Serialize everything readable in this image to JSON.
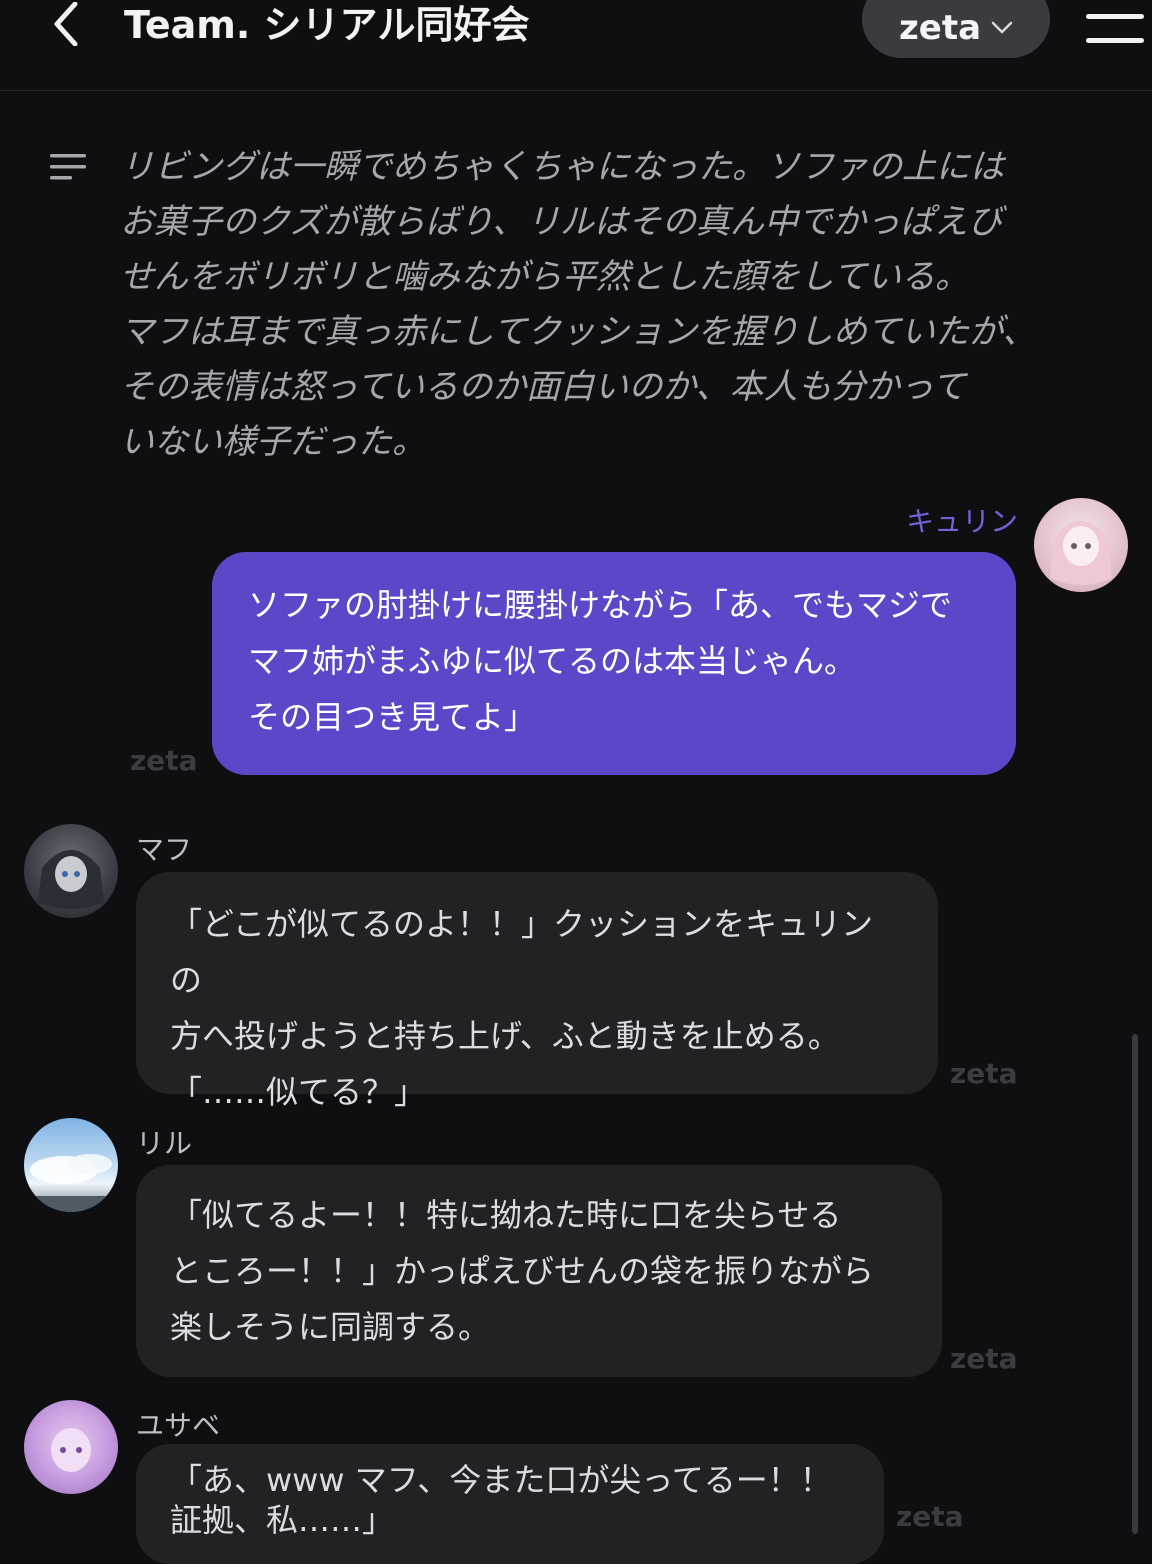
{
  "header": {
    "title": "Team. シリアル同好会",
    "model": "zeta"
  },
  "narration": {
    "text": "リビングは一瞬でめちゃくちゃになった。ソファの上には\nお菓子のクズが散らばり、リルはその真ん中でかっぱえび\nせんをボリボリと噛みながら平然とした顔をしている。\nマフは耳まで真っ赤にしてクッションを握りしめていたが、\nその表情は怒っているのか面白いのか、本人も分かって\nいない様子だった。"
  },
  "messages": [
    {
      "speaker": "キュリン",
      "text": "ソファの肘掛けに腰掛けながら「あ、でもマジで\nマフ姉がまふゆに似てるのは本当じゃん。\nその目つき見てよ」",
      "watermark": "zeta"
    },
    {
      "speaker": "マフ",
      "text": "「どこが似てるのよ！！」クッションをキュリンの\n方へ投げようと持ち上げ、ふと動きを止める。\n「……似てる？」",
      "watermark": "zeta"
    },
    {
      "speaker": "リル",
      "text": "「似てるよー！！特に拗ねた時に口を尖らせる\nところー！！」かっぱえびせんの袋を振りながら\n楽しそうに同調する。",
      "watermark": "zeta"
    },
    {
      "speaker": "ユサベ",
      "text": "「あ、www マフ、今また口が尖ってるー！！\n証拠、私……」",
      "watermark": "zeta"
    }
  ],
  "icons": {
    "back": "chevron-left-icon",
    "model_dropdown": "chevron-down-icon",
    "menu": "hamburger-menu-icon",
    "narration": "text-lines-icon"
  },
  "colors": {
    "background": "#0f0f11",
    "user_bubble": "#5a48c9",
    "ai_bubble": "#222225",
    "user_name": "#6e63d8"
  }
}
